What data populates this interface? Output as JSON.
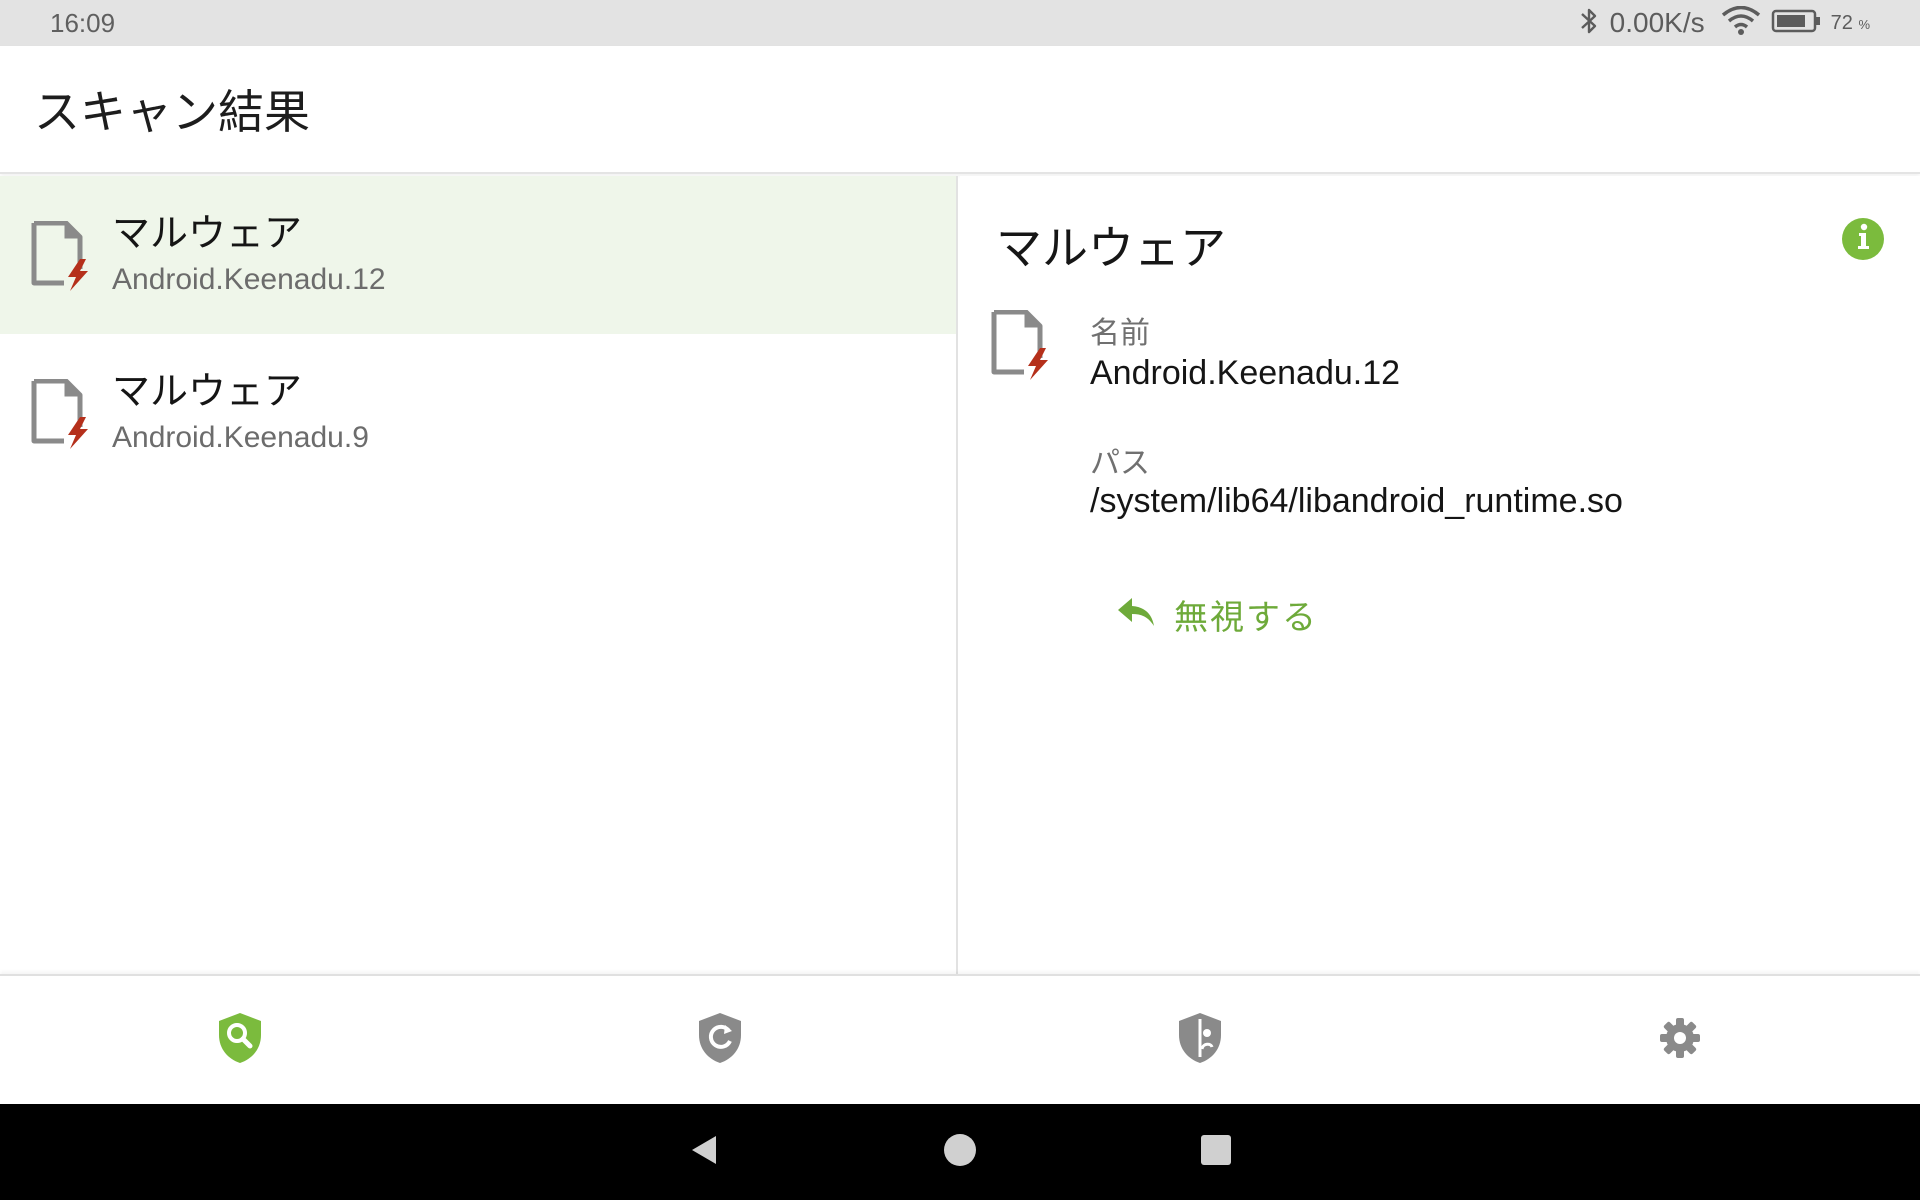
{
  "status_bar": {
    "time": "16:09",
    "net_speed": "0.00K/s",
    "battery_percent": "72",
    "battery_unit": "%",
    "icons": [
      "bluetooth-icon",
      "wifi-icon",
      "battery-icon"
    ]
  },
  "app_bar": {
    "title": "スキャン結果"
  },
  "results": [
    {
      "title": "マルウェア",
      "name": "Android.Keenadu.12",
      "selected": true
    },
    {
      "title": "マルウェア",
      "name": "Android.Keenadu.9",
      "selected": false
    }
  ],
  "detail": {
    "title": "マルウェア",
    "name_label": "名前",
    "name_value": "Android.Keenadu.12",
    "path_label": "パス",
    "path_value": "/system/lib64/libandroid_runtime.so",
    "ignore_label": "無視する"
  },
  "bottom_nav": {
    "tabs": [
      {
        "icon": "shield-search-icon",
        "active": true
      },
      {
        "icon": "shield-update-icon",
        "active": false
      },
      {
        "icon": "shield-security-icon",
        "active": false
      },
      {
        "icon": "gear-icon",
        "active": false
      }
    ]
  },
  "colors": {
    "accent": "#7bbb3d",
    "selected_row": "#eff6ea",
    "threat_red": "#b5301b",
    "icon_gray": "#8a8a8a"
  }
}
